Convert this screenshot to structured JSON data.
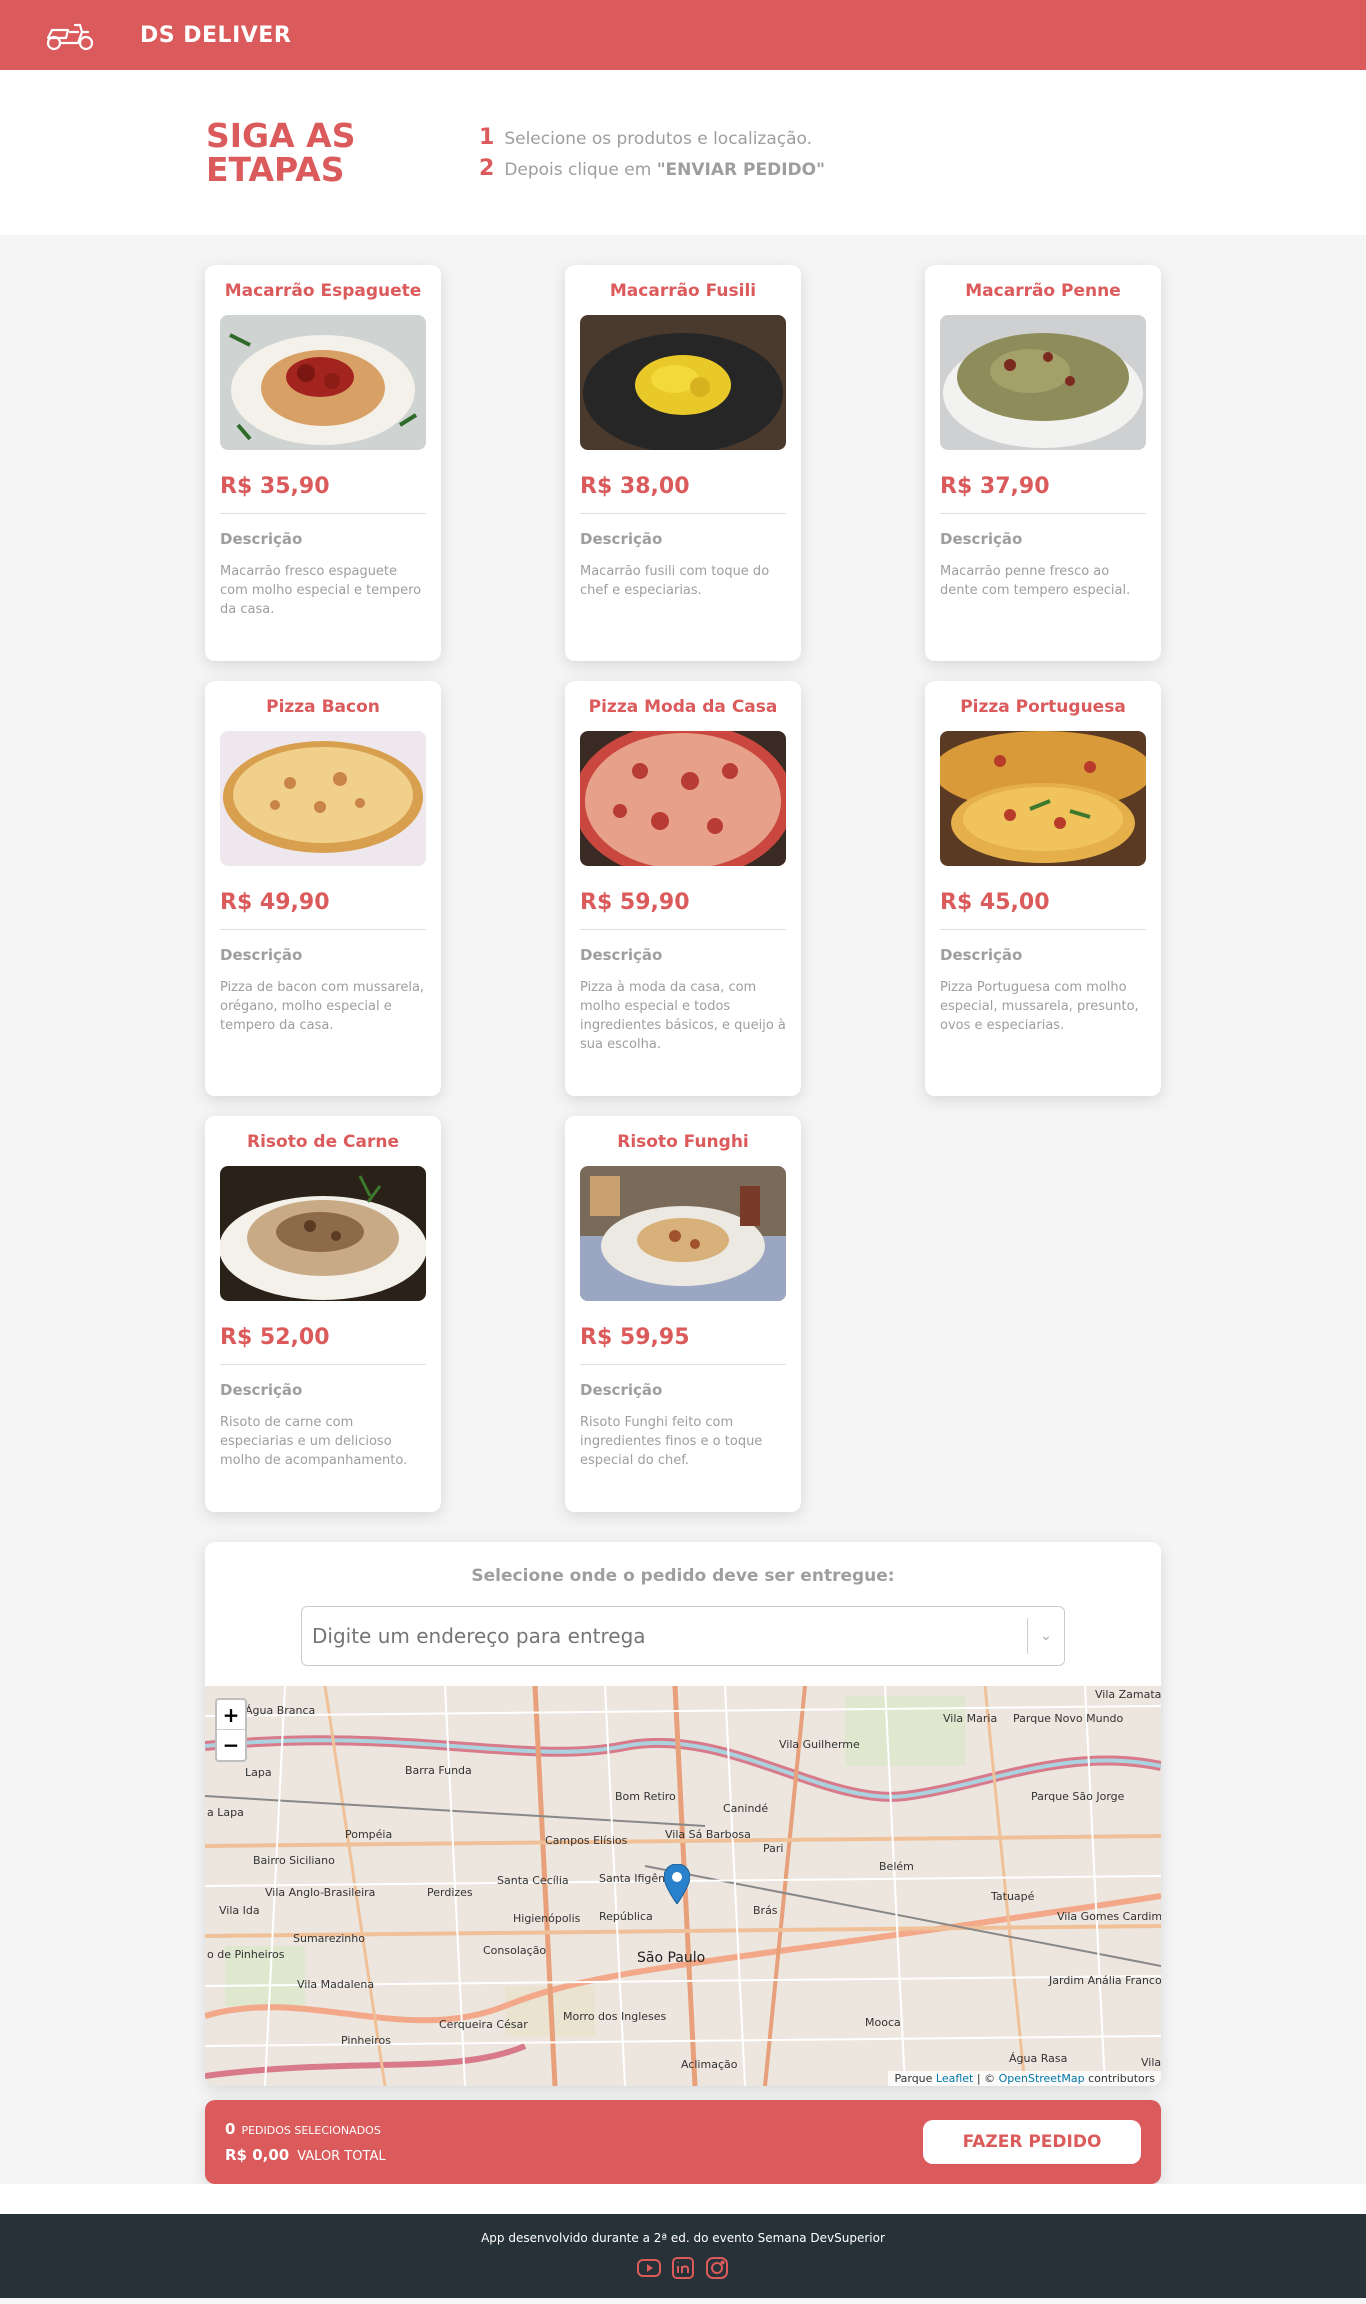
{
  "navbar": {
    "brand": "DS DELIVER",
    "logo_icon": "motorcycle-icon"
  },
  "steps": {
    "title_line1": "SIGA AS",
    "title_line2": "ETAPAS",
    "items": [
      {
        "number": "1",
        "text": "Selecione os produtos e localização.",
        "bold": ""
      },
      {
        "number": "2",
        "text": "Depois clique em ",
        "bold": "\"ENVIAR PEDIDO\""
      }
    ]
  },
  "products": [
    {
      "name": "Macarrão Espaguete",
      "price": "R$ 35,90",
      "description_label": "Descrição",
      "description": "Macarrão fresco espaguete com molho especial e tempero da casa."
    },
    {
      "name": "Macarrão Fusili",
      "price": "R$ 38,00",
      "description_label": "Descrição",
      "description": "Macarrão fusili com toque do chef e especiarias."
    },
    {
      "name": "Macarrão Penne",
      "price": "R$ 37,90",
      "description_label": "Descrição",
      "description": "Macarrão penne fresco ao dente com tempero especial."
    },
    {
      "name": "Pizza Bacon",
      "price": "R$ 49,90",
      "description_label": "Descrição",
      "description": "Pizza de bacon com mussarela, orégano, molho especial e tempero da casa."
    },
    {
      "name": "Pizza Moda da Casa",
      "price": "R$ 59,90",
      "description_label": "Descrição",
      "description": "Pizza à moda da casa, com molho especial e todos ingredientes básicos, e queijo à sua escolha."
    },
    {
      "name": "Pizza Portuguesa",
      "price": "R$ 45,00",
      "description_label": "Descrição",
      "description": "Pizza Portuguesa com molho especial, mussarela, presunto, ovos e especiarias."
    },
    {
      "name": "Risoto de Carne",
      "price": "R$ 52,00",
      "description_label": "Descrição",
      "description": "Risoto de carne com especiarias e um delicioso molho de acompanhamento."
    },
    {
      "name": "Risoto Funghi",
      "price": "R$ 59,95",
      "description_label": "Descrição",
      "description": "Risoto Funghi feito com ingredientes finos e o toque especial do chef."
    }
  ],
  "location": {
    "title": "Selecione onde o pedido deve ser entregue:",
    "address_placeholder": "Digite um endereço para entrega",
    "zoom_in": "+",
    "zoom_out": "−",
    "attribution_leaflet": "Leaflet",
    "attribution_sep": " | © ",
    "attribution_osm": "OpenStreetMap",
    "attribution_tail": " contributors",
    "attribution_lead": "Parque ",
    "map_labels": [
      "Água Branca",
      "Lapa",
      "Barra Funda",
      "Bom Retiro",
      "Canindé",
      "Vila Guilherme",
      "Vila Maria",
      "Parque Novo Mundo",
      "Parque São Jorge",
      "Pompéia",
      "Bairro Siciliano",
      "Campos Elísios",
      "Vila Sá Barbosa",
      "Pari",
      "Belém",
      "Santa Cecília",
      "Santa Ifigênia",
      "Perdizes",
      "Vila Anglo-Brasileira",
      "Vila Ida",
      "Higienópolis",
      "República",
      "Brás",
      "Tatuapé",
      "Vila Gomes Cardim",
      "Sumarezinho",
      "Consolação",
      "São Paulo",
      "Jardim Anália Franco",
      "Vila Madalena",
      "Cerqueira César",
      "Morro dos Ingleses",
      "Mooca",
      "Pinheiros",
      "Aclimação",
      "Água Rasa",
      "o de Pinheiros",
      "a Lapa",
      "Vila Zamataro",
      "Vila"
    ],
    "marker_icon": "map-pin-icon"
  },
  "summary": {
    "count": "0",
    "count_label": "PEDIDOS SELECIONADOS",
    "total": "R$ 0,00",
    "total_label": "VALOR TOTAL",
    "button": "FAZER PEDIDO"
  },
  "footer": {
    "text": "App desenvolvido durante a 2ª ed. do evento Semana DevSuperior",
    "icons": [
      "youtube-icon",
      "linkedin-icon",
      "instagram-icon"
    ]
  }
}
